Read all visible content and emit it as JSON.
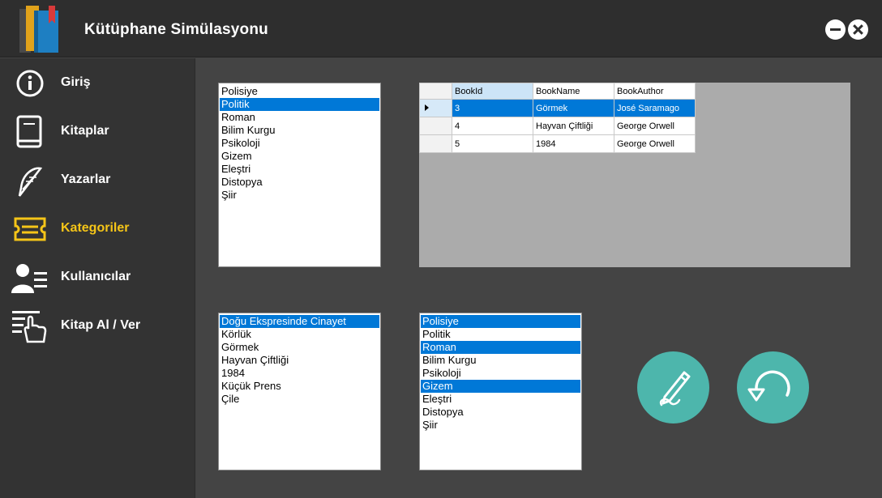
{
  "app": {
    "title": "Kütüphane Simülasyonu",
    "icons": {
      "logo": "books-logo-icon",
      "minimize": "minimize-icon",
      "close": "close-icon"
    }
  },
  "sidebar": {
    "items": [
      {
        "label": "Giriş",
        "icon": "info-icon",
        "active": false
      },
      {
        "label": "Kitaplar",
        "icon": "book-icon",
        "active": false
      },
      {
        "label": "Yazarlar",
        "icon": "feather-icon",
        "active": false
      },
      {
        "label": "Kategoriler",
        "icon": "ticket-icon",
        "active": true
      },
      {
        "label": "Kullanıcılar",
        "icon": "users-icon",
        "active": false
      },
      {
        "label": "Kitap Al / Ver",
        "icon": "hand-list-icon",
        "active": false
      }
    ],
    "active_color": "#f5c518"
  },
  "categories_list": {
    "items": [
      "Polisiye",
      "Politik",
      "Roman",
      "Bilim Kurgu",
      "Psikoloji",
      "Gizem",
      "Eleştri",
      "Distopya",
      "Şiir"
    ],
    "selected": [
      "Politik"
    ]
  },
  "books_grid": {
    "columns": [
      "BookId",
      "BookName",
      "BookAuthor"
    ],
    "rows": [
      {
        "id": "3",
        "name": "Görmek",
        "author": "José Saramago",
        "selected": true
      },
      {
        "id": "4",
        "name": "Hayvan Çiftliği",
        "author": "George Orwell",
        "selected": false
      },
      {
        "id": "5",
        "name": "1984",
        "author": "George Orwell",
        "selected": false
      }
    ]
  },
  "books_list": {
    "items": [
      "Doğu Ekspresinde Cinayet",
      "Körlük",
      "Görmek",
      "Hayvan Çiftliği",
      "1984",
      "Küçük Prens",
      "Çile"
    ],
    "selected": [
      "Doğu Ekspresinde Cinayet"
    ]
  },
  "book_categories_list": {
    "items": [
      "Polisiye",
      "Politik",
      "Roman",
      "Bilim Kurgu",
      "Psikoloji",
      "Gizem",
      "Eleştri",
      "Distopya",
      "Şiir"
    ],
    "selected": [
      "Polisiye",
      "Roman",
      "Gizem"
    ]
  },
  "actions": {
    "edit_icon": "pencil-icon",
    "reset_icon": "undo-icon",
    "color": "#4db6ac"
  },
  "colors": {
    "selection": "#0078d7",
    "background": "#444444",
    "sidebar": "#333333"
  }
}
